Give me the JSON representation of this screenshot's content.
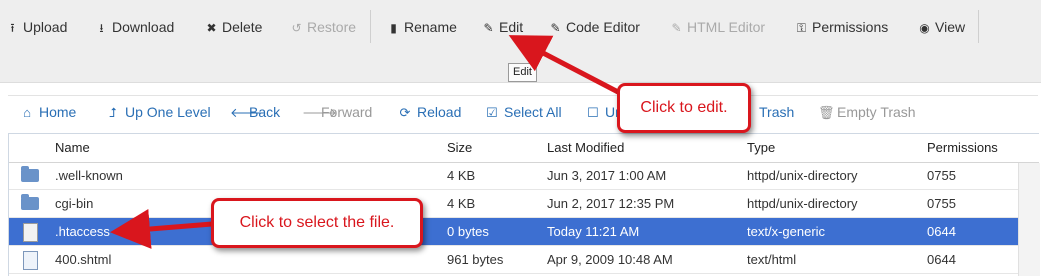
{
  "toolbar": {
    "upload": "Upload",
    "download": "Download",
    "delete": "Delete",
    "restore": "Restore",
    "rename": "Rename",
    "edit": "Edit",
    "code_editor": "Code Editor",
    "html_editor": "HTML Editor",
    "permissions": "Permissions",
    "view": "View"
  },
  "tooltip": "Edit",
  "nav": {
    "home": "Home",
    "up_one_level": "Up One Level",
    "back": "Back",
    "forward": "Forward",
    "reload": "Reload",
    "select_all": "Select All",
    "unselect_all_partial": "Ur",
    "trash_partial": "Trash",
    "empty_trash": "Empty Trash"
  },
  "table": {
    "headers": {
      "name": "Name",
      "size": "Size",
      "modified": "Last Modified",
      "type": "Type",
      "permissions": "Permissions"
    },
    "rows": [
      {
        "name": ".well-known",
        "size": "4 KB",
        "modified": "Jun 3, 2017 1:00 AM",
        "type": "httpd/unix-directory",
        "perms": "0755",
        "icon": "folder-icon"
      },
      {
        "name": "cgi-bin",
        "size": "4 KB",
        "modified": "Jun 2, 2017 12:35 PM",
        "type": "httpd/unix-directory",
        "perms": "0755",
        "icon": "folder-icon"
      },
      {
        "name": ".htaccess",
        "size": "0 bytes",
        "modified": "Today 11:21 AM",
        "type": "text/x-generic",
        "perms": "0644",
        "icon": "file-icon",
        "selected": true
      },
      {
        "name": "400.shtml",
        "size": "961 bytes",
        "modified": "Apr 9, 2009 10:48 AM",
        "type": "text/html",
        "perms": "0644",
        "icon": "html-file-icon"
      }
    ]
  },
  "callouts": {
    "edit": "Click to edit.",
    "select": "Click to select the file."
  },
  "colors": {
    "selected_row": "#3d6fd1",
    "callout_red": "#d9161d",
    "nav_link": "#2a6fb5"
  }
}
